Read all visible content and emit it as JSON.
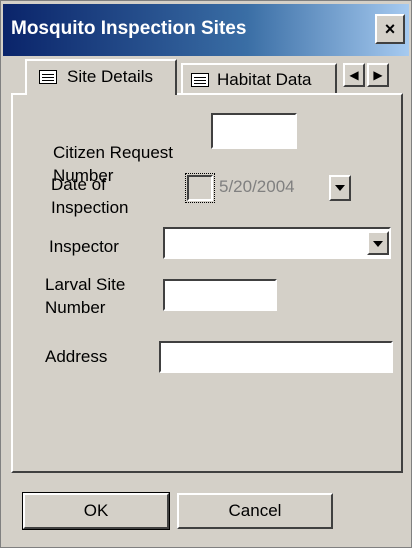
{
  "window": {
    "title": "Mosquito Inspection Sites",
    "close_label": "×"
  },
  "tabs": [
    {
      "label": "Site Details",
      "icon": "form-icon",
      "active": true
    },
    {
      "label": "Habitat Data",
      "icon": "form-icon",
      "active": false
    }
  ],
  "tab_scroll": {
    "left": "◀",
    "right": "▶"
  },
  "form": {
    "citizen_request": {
      "label": "Citizen Request Number",
      "value": ""
    },
    "date": {
      "label": "Date of Inspection",
      "value": "5/20/2004",
      "checked": false
    },
    "inspector": {
      "label": "Inspector",
      "value": ""
    },
    "larval_site": {
      "label": "Larval Site Number",
      "value": ""
    },
    "address": {
      "label": "Address",
      "value": ""
    }
  },
  "buttons": {
    "ok": "OK",
    "cancel": "Cancel"
  }
}
